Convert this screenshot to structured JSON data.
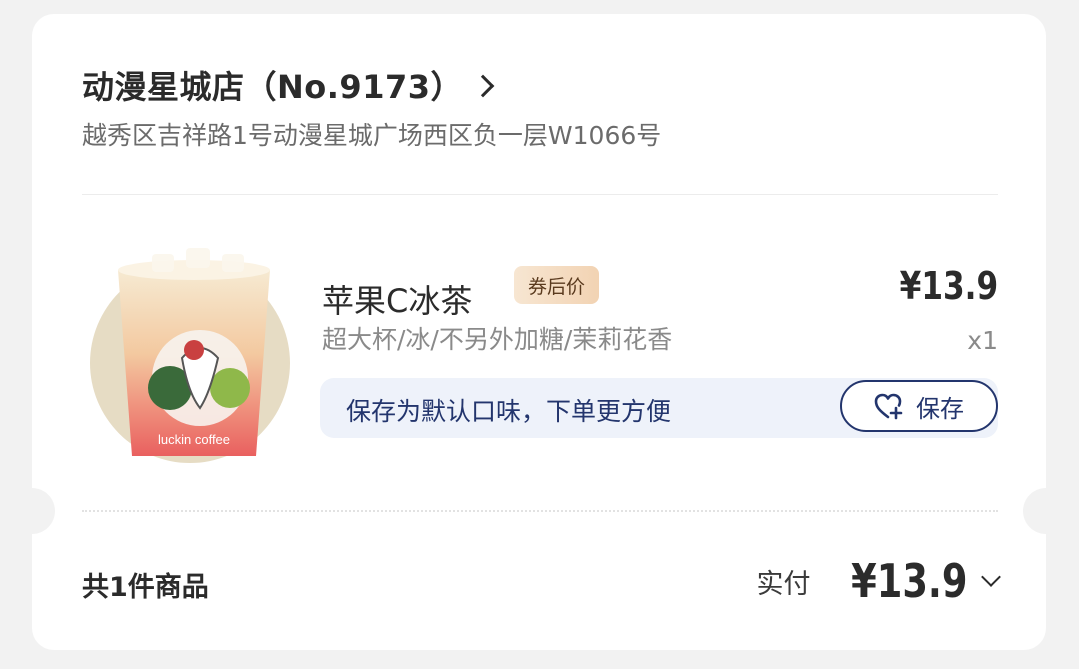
{
  "store": {
    "name": "动漫星城店（No.9173）",
    "address": "越秀区吉祥路1号动漫星城广场西区负一层W1066号"
  },
  "product": {
    "name": "苹果C冰茶",
    "badge": "券后价",
    "price": "¥13.9",
    "spec": "超大杯/冰/不另外加糖/茉莉花香",
    "quantity": "x1",
    "cup_brand": "luckin coffee"
  },
  "save_prompt": {
    "text": "保存为默认口味，下单更方便",
    "button_label": "保存",
    "button_icon": "heart-plus-icon"
  },
  "footer": {
    "item_count": "共1件商品",
    "total_label": "实付",
    "total_value": "¥13.9"
  },
  "colors": {
    "accent_navy": "#23356d",
    "badge_bg": "#f2d3b3",
    "save_bar_bg": "#eef2fa"
  }
}
